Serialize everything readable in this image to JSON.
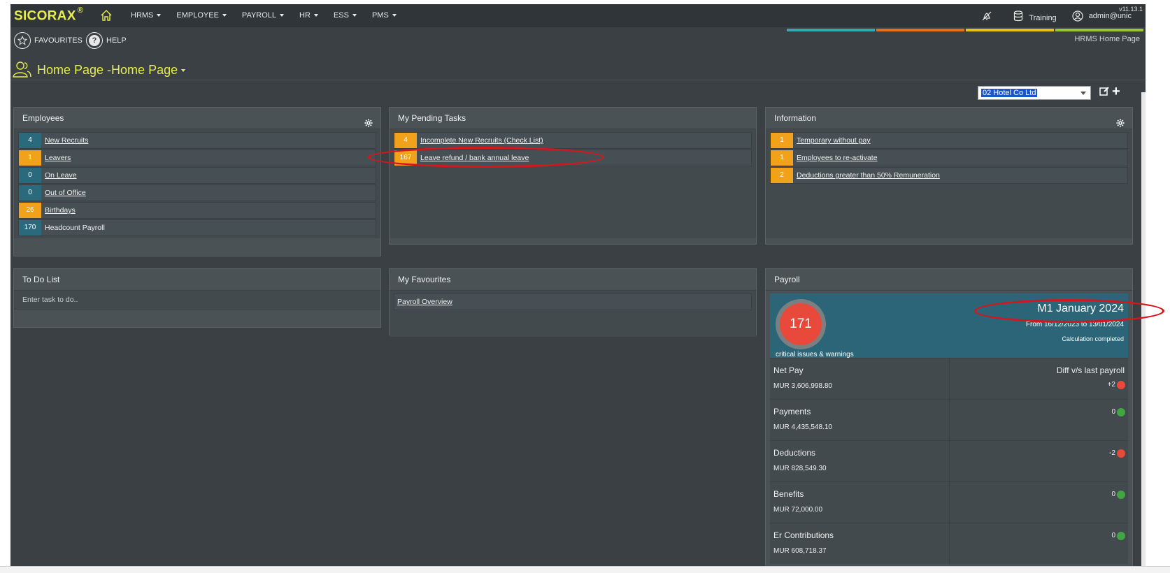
{
  "app": {
    "logo": "SICORAX",
    "logo_reg": "®",
    "version": "v11.13.1",
    "nav": [
      "HRMS",
      "EMPLOYEE",
      "PAYROLL",
      "HR",
      "ESS",
      "PMS"
    ],
    "environment": "Training",
    "user": "admin@unic",
    "colorbar": [
      "#3aa6b0",
      "#e2731c",
      "#e6c31c",
      "#9bc53d"
    ]
  },
  "subbar": {
    "favourites": "FAVOURITES",
    "help": "HELP",
    "page_ref": "HRMS Home Page"
  },
  "page": {
    "title": "Home Page -Home Page",
    "company": "02 Hotel Co Ltd"
  },
  "employees": {
    "title": "Employees",
    "rows": [
      {
        "count": "4",
        "label": "New Recruits",
        "color": "blue"
      },
      {
        "count": "1",
        "label": "Leavers",
        "color": "orange"
      },
      {
        "count": "0",
        "label": "On Leave",
        "color": "blue"
      },
      {
        "count": "0",
        "label": "Out of Office",
        "color": "blue"
      },
      {
        "count": "26",
        "label": "Birthdays",
        "color": "orange"
      },
      {
        "count": "170",
        "label": "Headcount Payroll",
        "color": "blue"
      }
    ]
  },
  "pending": {
    "title": "My Pending Tasks",
    "rows": [
      {
        "count": "4",
        "label": "Incomplete New Recruits (Check List)"
      },
      {
        "count": "167",
        "label": "Leave refund / bank annual leave"
      }
    ]
  },
  "information": {
    "title": "Information",
    "rows": [
      {
        "count": "1",
        "label": "Temporary without pay"
      },
      {
        "count": "1",
        "label": "Employees to re-activate"
      },
      {
        "count": "2",
        "label": "Deductions greater than 50% Remuneration"
      }
    ]
  },
  "todo": {
    "title": "To Do List",
    "placeholder": "Enter task to do.."
  },
  "favourites": {
    "title": "My Favourites",
    "items": [
      "Payroll Overview"
    ]
  },
  "payroll": {
    "title": "Payroll",
    "issues": "171",
    "issues_label": "critical issues & warnings",
    "period": "M1 January 2024",
    "range": "From 16/12/2023 to 13/01/2024",
    "status": "Calculation completed",
    "diff_header": "Diff v/s last payroll",
    "rows": [
      {
        "label": "Net Pay",
        "amount": "MUR 3,606,998.80",
        "diff": "+2",
        "status": "red"
      },
      {
        "label": "Payments",
        "amount": "MUR 4,435,548.10",
        "diff": "0",
        "status": "green"
      },
      {
        "label": "Deductions",
        "amount": "MUR 828,549.30",
        "diff": "-2",
        "status": "red"
      },
      {
        "label": "Benefits",
        "amount": "MUR 72,000.00",
        "diff": "0",
        "status": "green"
      },
      {
        "label": "Er Contributions",
        "amount": "MUR 608,718.37",
        "diff": "0",
        "status": "green"
      }
    ]
  }
}
